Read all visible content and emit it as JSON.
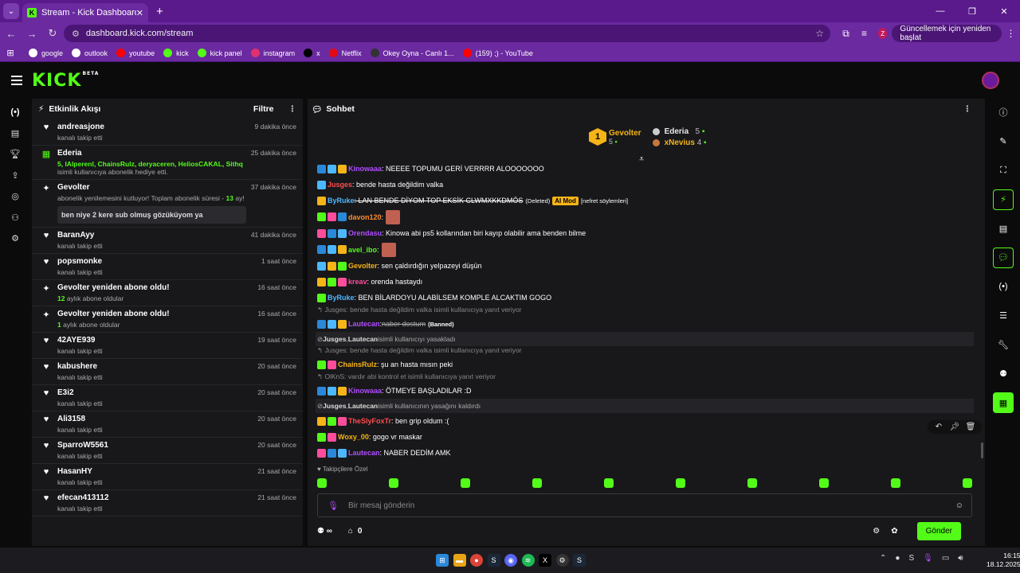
{
  "browser": {
    "tab_title": "Stream - Kick Dashboard",
    "url": "dashboard.kick.com/stream",
    "update_label": "Güncellemek için yeniden başlat",
    "profile_initial": "Z",
    "bookmarks": [
      {
        "label": "google",
        "color": "#ffffff"
      },
      {
        "label": "outlook",
        "color": "#ffffff"
      },
      {
        "label": "youtube",
        "color": "#ff0000"
      },
      {
        "label": "kick",
        "color": "#53fc18"
      },
      {
        "label": "kick panel",
        "color": "#53fc18"
      },
      {
        "label": "instagram",
        "color": "#e1306c"
      },
      {
        "label": "x",
        "color": "#000000"
      },
      {
        "label": "Netflix",
        "color": "#e50914"
      },
      {
        "label": "Okey Oyna - Canlı 1...",
        "color": "#333333"
      },
      {
        "label": "(159) ;) - YouTube",
        "color": "#ff0000"
      }
    ]
  },
  "kick": {
    "logo": "KICK",
    "beta": "BETA"
  },
  "activity": {
    "title": "Etkinlik Akışı",
    "filter": "Filtre",
    "items": [
      {
        "icon": "heart-icon",
        "name": "andreasjone",
        "sub": "kanalı takip etti",
        "time": "9 dakika önce"
      },
      {
        "icon": "gift-icon",
        "name": "Ederia",
        "gifted": "5, lAlperenl, ChainsRulz, deryaceren, HeliosCAKAL, Sithq",
        "sub": "isimli kullanıcıya abonelik hediye etti.",
        "time": "25 dakika önce"
      },
      {
        "icon": "star-icon",
        "name": "Gevolter",
        "sub": "abonelik yenilemesini kutluyor! Toplam abonelik süresi - ",
        "months": "13",
        "sub_end": " ay!",
        "message": "ben niye 2 kere sub olmuş gözüküyom ya",
        "time": "37 dakika önce"
      },
      {
        "icon": "heart-icon",
        "name": "BaranAyy",
        "sub": "kanalı takip etti",
        "time": "41 dakika önce"
      },
      {
        "icon": "heart-icon",
        "name": "popsmonke",
        "sub": "kanalı takip etti",
        "time": "1 saat önce"
      },
      {
        "icon": "star-icon",
        "name": "Gevolter yeniden abone oldu!",
        "count": "12",
        "sub": "aylık abone oldular",
        "time": "16 saat önce"
      },
      {
        "icon": "star-icon",
        "name": "Gevolter yeniden abone oldu!",
        "count": "1",
        "sub": "aylık abone oldular",
        "time": "16 saat önce"
      },
      {
        "icon": "heart-icon",
        "name": "42AYE939",
        "sub": "kanalı takip etti",
        "time": "19 saat önce"
      },
      {
        "icon": "heart-icon",
        "name": "kabushere",
        "sub": "kanalı takip etti",
        "time": "20 saat önce"
      },
      {
        "icon": "heart-icon",
        "name": "E3i2",
        "sub": "kanalı takip etti",
        "time": "20 saat önce"
      },
      {
        "icon": "heart-icon",
        "name": "Ali3158",
        "sub": "kanalı takip etti",
        "time": "20 saat önce"
      },
      {
        "icon": "heart-icon",
        "name": "SparroW5561",
        "sub": "kanalı takip etti",
        "time": "20 saat önce"
      },
      {
        "icon": "heart-icon",
        "name": "HasanHY",
        "sub": "kanalı takip etti",
        "time": "21 saat önce"
      },
      {
        "icon": "heart-icon",
        "name": "efecan413112",
        "sub": "kanalı takip etti",
        "time": "21 saat önce"
      }
    ]
  },
  "chat": {
    "title": "Sohbet",
    "leaderboard": {
      "first": {
        "rank": "1",
        "name": "Gevolter",
        "count": "5"
      },
      "second": {
        "name": "Ederia",
        "count": "5"
      },
      "third": {
        "name": "xNevius",
        "count": "4"
      }
    },
    "messages": [
      {
        "user": "Kinowaaa",
        "color": "#b04cff",
        "text": ": NEEEE TOPUMU GERİ VERRRR ALOOOOOOO"
      },
      {
        "user": "Jusges",
        "color": "#ff4d4d",
        "text": ": bende hasta değildim valka"
      },
      {
        "user": "ByRuke",
        "color": "#4db8ff",
        "text": ": LAN BENDE DİYOM TOP EKSİK CLWMXKKDMÖS",
        "deleted": "(Deleted)",
        "aimod": "AI Mod",
        "reason": "[nefret söylemleri]"
      },
      {
        "user": "davon120",
        "color": "#ff8c2a",
        "text": ":"
      },
      {
        "user": "Orendasu",
        "color": "#b04cff",
        "text": ": Kinowa abi ps5 kollarından biri kayıp olabilir ama benden bilme"
      },
      {
        "user": "avel_ibo",
        "color": "#53fc18",
        "text": ":"
      },
      {
        "user": "Gevolter",
        "color": "#f5b417",
        "text": ": sen çaldırdığın yelpazeyi düşün"
      },
      {
        "user": "kreav",
        "color": "#ff4d9d",
        "text": ": orenda hastaydı"
      },
      {
        "user": "ByRuke",
        "color": "#4db8ff",
        "text": ": BEN BİLARDOYU ALABİLSEM KOMPLE ALCAKTIM GOGO"
      },
      {
        "reply": "Jusges: bende hasta değildim valka isimli kullanıcıya yanıt veriyor"
      },
      {
        "user": "Lautecan",
        "color": "#b04cff",
        "text": "naber dostum",
        "banned": "(Banned)"
      },
      {
        "sys_a": "Jusges",
        "sys_b": "Lautecan",
        "sys_text": "isimli kullanıcıyı yasakladı"
      },
      {
        "reply": "Jusges: bende hasta değildim valka isimli kullanıcıya yanıt veriyor"
      },
      {
        "user": "ChainsRulz",
        "color": "#f5b417",
        "text": ": şu an hasta mısın peki"
      },
      {
        "reply": "OlKnS: vardır abi kontrol et isimli kullanıcıya yanıt veriyor"
      },
      {
        "user": "Kinowaaa",
        "color": "#b04cff",
        "text": ": ÖTMEYE BAŞLADILAR :D"
      },
      {
        "sys_a": "Jusges",
        "sys_b": "Lautecan",
        "sys_text": "isimli kullanıcının yasağını kaldırdı"
      },
      {
        "user": "TheSlyFoxTr",
        "color": "#ff4d4d",
        "text": ": ben grip oldum :("
      },
      {
        "user": "Woxy_00",
        "color": "#f5b417",
        "text": ": gogo vr maskar"
      },
      {
        "user": "Lautecan",
        "color": "#b04cff",
        "text": ": NABER DEDİM AMK"
      }
    ],
    "followers_only": "Takipçilere Özel",
    "input_placeholder": "Bir mesaj gönderin",
    "points": "0",
    "send_label": "Gönder"
  },
  "taskbar": {
    "time": "16:15",
    "date": "18.12.2025"
  }
}
